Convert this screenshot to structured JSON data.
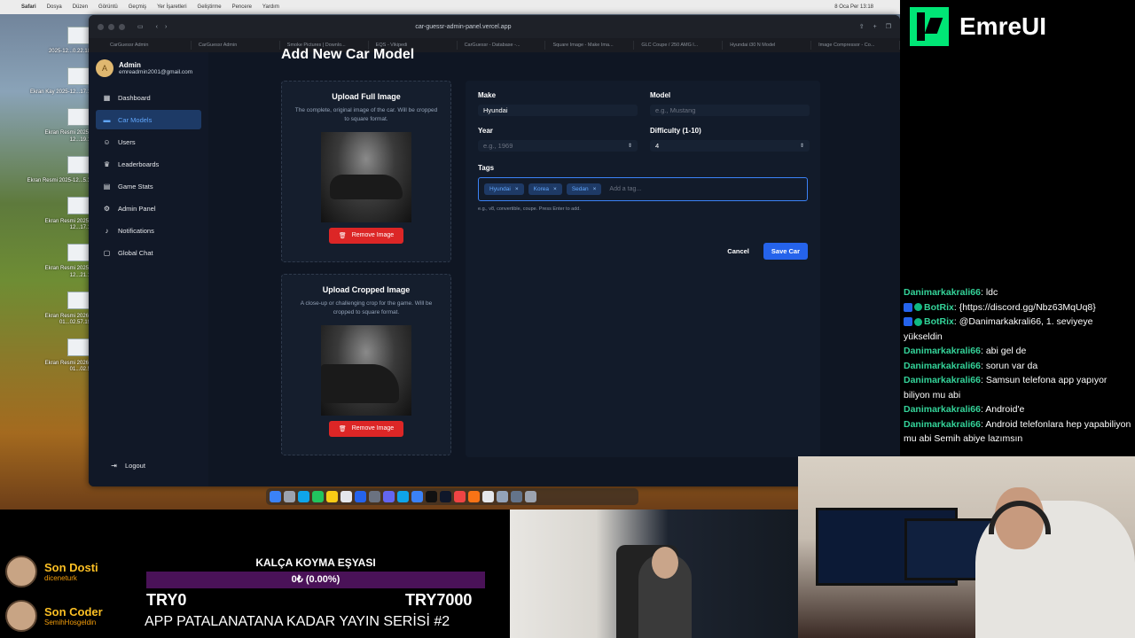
{
  "menubar": {
    "app": "Safari",
    "items": [
      "Dosya",
      "Düzen",
      "Görüntü",
      "Geçmiş",
      "Yer İşaretleri",
      "Geliştirme",
      "Pencere",
      "Yardım"
    ],
    "clock": "8 Oca Per 13:18"
  },
  "desktop_icons": [
    {
      "caption": "2025-12...0.22.18"
    },
    {
      "caption": "Ekran Kay 2025-12...17.1"
    },
    {
      "caption": "Ekran Resmi 2025-12...19.1"
    },
    {
      "caption": "Ekran Resmi 2025-12...5.3"
    },
    {
      "caption": "Ekran Resmi 2025-12...17.1"
    },
    {
      "caption": "Ekran Resmi 2025-12...21.1"
    },
    {
      "caption": "Ekran Resmi 2026-01...02.57.19"
    },
    {
      "caption": "Ekran Resmi 2026-01...02.5"
    }
  ],
  "browser": {
    "url": "car-guessr-admin-panel.vercel.app",
    "tabs": [
      "CarGuessr Admin",
      "CarGuessr Admin",
      "Smoke Pictures | Downlo...",
      "EQS - Vikipedi",
      "CarGuessr - Database -...",
      "Square Image - Make Ima...",
      "GLC Coupe / 250 AMG l...",
      "Hyundai i30 N Model",
      "Image Compressor - Co..."
    ]
  },
  "sidebar": {
    "user": {
      "name": "Admin",
      "email": "emreadmin2001@gmail.com",
      "initial": "A"
    },
    "items": [
      {
        "label": "Dashboard",
        "icon": "▦"
      },
      {
        "label": "Car Models",
        "icon": "▬"
      },
      {
        "label": "Users",
        "icon": "☺"
      },
      {
        "label": "Leaderboards",
        "icon": "♛"
      },
      {
        "label": "Game Stats",
        "icon": "▤"
      },
      {
        "label": "Admin Panel",
        "icon": "⚙"
      },
      {
        "label": "Notifications",
        "icon": "♪"
      },
      {
        "label": "Global Chat",
        "icon": "▢"
      }
    ],
    "logout": "Logout"
  },
  "page": {
    "title": "Add New Car Model",
    "full_upload": {
      "title": "Upload Full Image",
      "desc": "The complete, original image of the car. Will be cropped to square format.",
      "remove": "Remove Image"
    },
    "crop_upload": {
      "title": "Upload Cropped Image",
      "desc": "A close-up or challenging crop for the game. Will be cropped to square format.",
      "remove": "Remove Image"
    },
    "form": {
      "make_label": "Make",
      "make_value": "Hyundai",
      "model_label": "Model",
      "model_placeholder": "e.g., Mustang",
      "year_label": "Year",
      "year_placeholder": "e.g., 1969",
      "difficulty_label": "Difficulty (1-10)",
      "difficulty_value": "4",
      "tags_label": "Tags",
      "tags": [
        "Hyundai",
        "Korea",
        "Sedan"
      ],
      "tag_placeholder": "Add a tag...",
      "tags_hint": "e.g., v8, convertible, coupe. Press Enter to add.",
      "cancel": "Cancel",
      "save": "Save Car"
    }
  },
  "stream": {
    "brand": "EmreUI",
    "chat": [
      {
        "user": "Danimarkakrali66",
        "msg": "ldc"
      },
      {
        "user": "BotRix",
        "bot": true,
        "msg": "{https://discord.gg/Nbz63MqUq8}"
      },
      {
        "user": "BotRix",
        "bot": true,
        "msg": "@Danimarkakrali66, 1. seviyeye yükseldin"
      },
      {
        "user": "Danimarkakrali66",
        "msg": "abi gel de"
      },
      {
        "user": "Danimarkakrali66",
        "msg": "sorun var da"
      },
      {
        "user": "Danimarkakrali66",
        "msg": "Samsun telefona app yapıyor biliyon mu abi"
      },
      {
        "user": "Danimarkakrali66",
        "msg": "Android'e"
      },
      {
        "user": "Danimarkakrali66",
        "msg": "Android telefonlara hep yapabiliyon mu abi Semih abiye lazımsın"
      }
    ],
    "last_follow": {
      "title": "Son Dosti",
      "name": "diceneturk"
    },
    "last_coder": {
      "title": "Son Coder",
      "name": "SemihHosgeldin"
    },
    "goal": {
      "title": "KALÇA KOYMA EŞYASI",
      "progress_text": "0₺ (0.00%)",
      "progress": 0,
      "min": "TRY0",
      "max": "TRY7000"
    },
    "series": "APP PATALANATANA KADAR YAYIN SERİSİ #2"
  }
}
